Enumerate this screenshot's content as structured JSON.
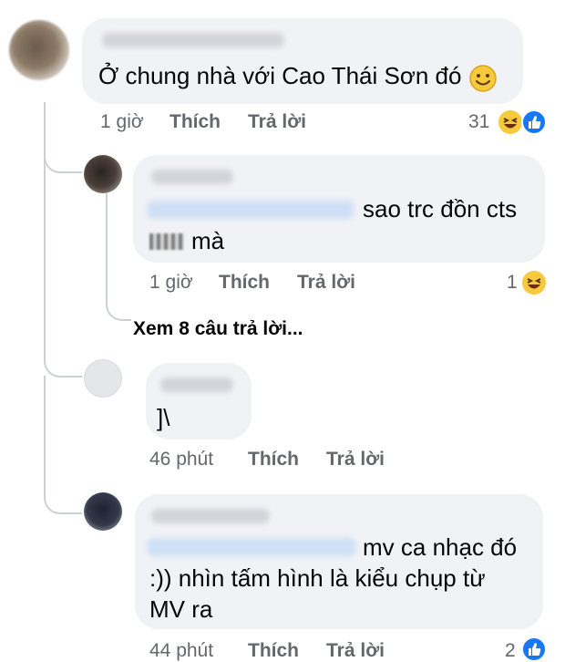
{
  "comments": [
    {
      "text": "Ở chung nhà với Cao Thái Sơn đó",
      "time": "1 giờ",
      "like": "Thích",
      "reply": "Trả lời",
      "reactions": "31"
    },
    {
      "text_line1": "sao trc đồn cts",
      "text_line2": "mà",
      "time": "1 giờ",
      "like": "Thích",
      "reply": "Trả lời",
      "reactions": "1"
    },
    {
      "text": "]\\",
      "time": "46 phút",
      "like": "Thích",
      "reply": "Trả lời"
    },
    {
      "text_line1": "mv ca nhạc đó",
      "text_line2": ":)) nhìn tấm hình là kiểu chụp từ",
      "text_line3": "MV ra",
      "time": "44 phút",
      "like": "Thích",
      "reply": "Trả lời",
      "reactions": "2"
    }
  ],
  "view_replies": "Xem 8 câu trả lời...",
  "icons": {
    "haha": "haha-reaction-icon",
    "like": "like-reaction-icon",
    "smile": "smile-emoji-icon"
  },
  "colors": {
    "bubble": "#f0f2f5",
    "meta": "#65676b",
    "like_blue": "#1877f2",
    "haha_yellow": "#f7c93c"
  }
}
